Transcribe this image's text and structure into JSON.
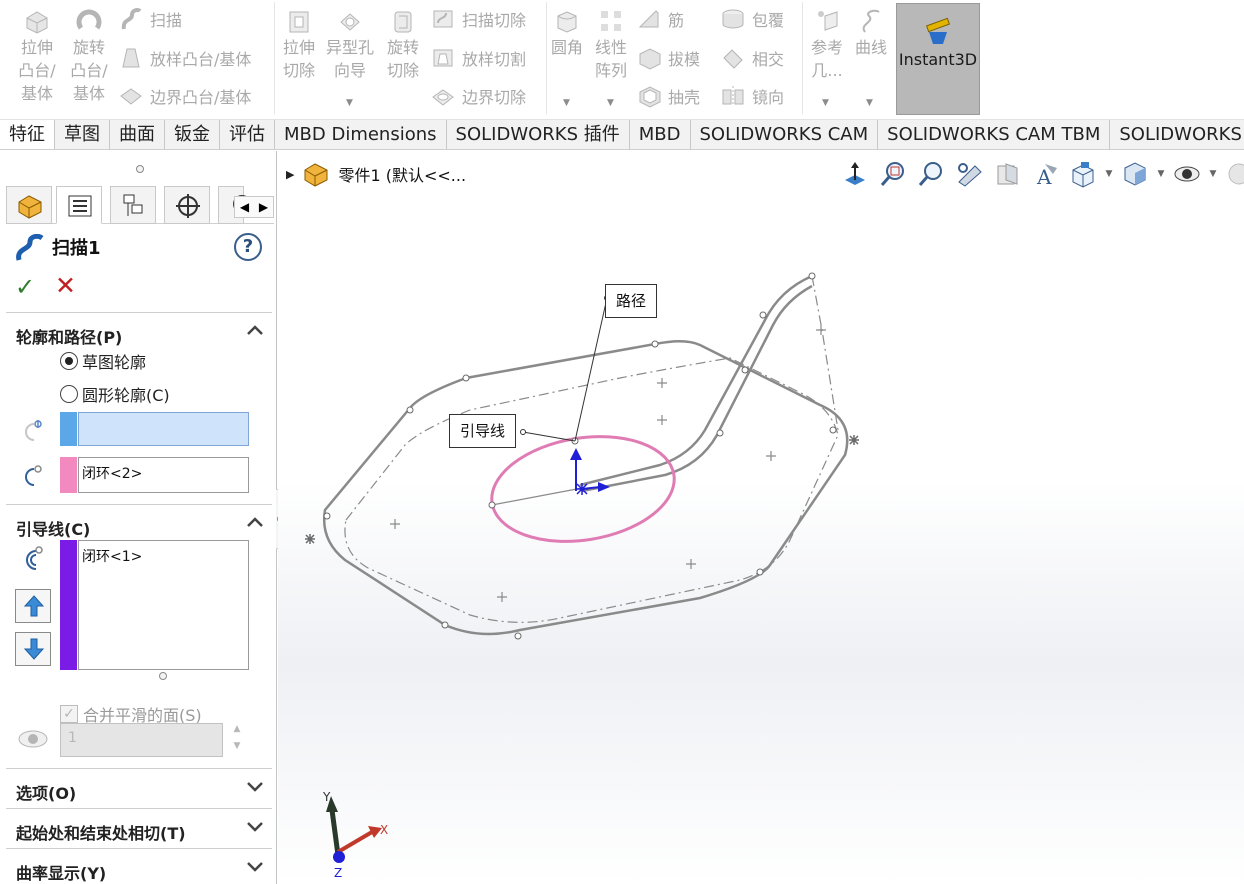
{
  "ribbon": {
    "extrude_boss": "拉伸凸台/基体",
    "revolve_boss": "旋转凸台/基体",
    "sweep": "扫描",
    "loft_boss": "放样凸台/基体",
    "boundary_boss": "边界凸台/基体",
    "extrude_cut": "拉伸切除",
    "hole_wizard": "异型孔向导",
    "revolve_cut": "旋转切除",
    "swept_cut": "扫描切除",
    "lofted_cut": "放样切割",
    "boundary_cut": "边界切除",
    "fillet": "圆角",
    "linear_pattern": "线性阵列",
    "rib": "筋",
    "draft": "拔模",
    "shell": "抽壳",
    "wrap": "包覆",
    "intersect": "相交",
    "mirror": "镜向",
    "reference_geometry": "参考几...",
    "curves": "曲线",
    "instant3d": "Instant3D"
  },
  "tabs": [
    "特征",
    "草图",
    "曲面",
    "钣金",
    "评估",
    "MBD Dimensions",
    "SOLIDWORKS 插件",
    "MBD",
    "SOLIDWORKS CAM",
    "SOLIDWORKS CAM TBM",
    "SOLIDWORKS Insp"
  ],
  "pm": {
    "title": "扫描1",
    "help": "?",
    "ok": "✓",
    "cancel": "✕",
    "profile_path": {
      "header": "轮廓和路径(P)",
      "opt_sketch": "草图轮廓",
      "opt_circle": "圆形轮廓(C)",
      "profile_value": "",
      "path_value": "闭环<2>",
      "profile_color": "#5ba7e8",
      "path_color": "#f28ac0"
    },
    "guides": {
      "header": "引导线(C)",
      "value": "闭环<1>",
      "color": "#7b1ce6",
      "merge_label": "合并平滑的面(S)",
      "spin_value": "1"
    },
    "options_header": "选项(O)",
    "tangency_header": "起始处和结束处相切(T)",
    "curvature_header": "曲率显示(Y)"
  },
  "viewport": {
    "part_name": "零件1  (默认<<...",
    "callout_path": "路径",
    "callout_guide": "引导线",
    "triad": {
      "x": "X",
      "y": "Y",
      "z": "Z"
    }
  },
  "colors": {
    "sketch_gray": "#8a8a8a",
    "profile_pink": "#e07cb4",
    "triad_blue": "#1f1fd6",
    "tab_active": "#ffffff",
    "instant3d_bg": "#b8b8b8"
  }
}
